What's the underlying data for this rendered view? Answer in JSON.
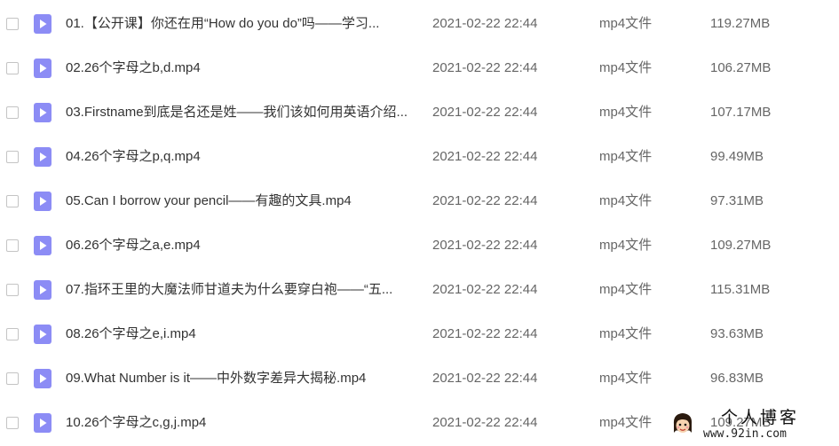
{
  "colors": {
    "video_icon": "#8c8cf5",
    "name_text": "#333333",
    "meta_text": "#666666"
  },
  "files": [
    {
      "name": "01.【公开课】你还在用“How do you do”吗——学习...",
      "date": "2021-02-22 22:44",
      "type": "mp4文件",
      "size": "119.27MB",
      "icon": "video-file-icon"
    },
    {
      "name": "02.26个字母之b,d.mp4",
      "date": "2021-02-22 22:44",
      "type": "mp4文件",
      "size": "106.27MB",
      "icon": "video-file-icon"
    },
    {
      "name": "03.Firstname到底是名还是姓——我们该如何用英语介绍...",
      "date": "2021-02-22 22:44",
      "type": "mp4文件",
      "size": "107.17MB",
      "icon": "video-file-icon"
    },
    {
      "name": "04.26个字母之p,q.mp4",
      "date": "2021-02-22 22:44",
      "type": "mp4文件",
      "size": "99.49MB",
      "icon": "video-file-icon"
    },
    {
      "name": "05.Can I borrow your pencil——有趣的文具.mp4",
      "date": "2021-02-22 22:44",
      "type": "mp4文件",
      "size": "97.31MB",
      "icon": "video-file-icon"
    },
    {
      "name": "06.26个字母之a,e.mp4",
      "date": "2021-02-22 22:44",
      "type": "mp4文件",
      "size": "109.27MB",
      "icon": "video-file-icon"
    },
    {
      "name": "07.指环王里的大魔法师甘道夫为什么要穿白袍——“五...",
      "date": "2021-02-22 22:44",
      "type": "mp4文件",
      "size": "115.31MB",
      "icon": "video-file-icon"
    },
    {
      "name": "08.26个字母之e,i.mp4",
      "date": "2021-02-22 22:44",
      "type": "mp4文件",
      "size": "93.63MB",
      "icon": "video-file-icon"
    },
    {
      "name": "09.What Number is it——中外数字差异大揭秘.mp4",
      "date": "2021-02-22 22:44",
      "type": "mp4文件",
      "size": "96.83MB",
      "icon": "video-file-icon"
    },
    {
      "name": "10.26个字母之c,g,j.mp4",
      "date": "2021-02-22 22:44",
      "type": "mp4文件",
      "size": "109.27MB",
      "icon": "video-file-icon"
    }
  ],
  "watermark": {
    "title": "个人博客",
    "url": "www.92in.com"
  }
}
